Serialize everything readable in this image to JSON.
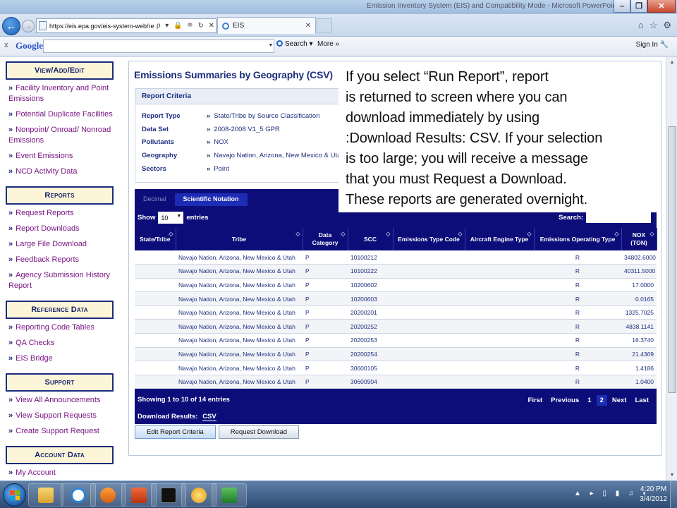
{
  "window": {
    "title": "Emission Inventory System (EIS) and Compatibility Mode - Microsoft PowerPoint",
    "minimize": "–",
    "restore": "❐",
    "close": "✕"
  },
  "browser": {
    "back": "←",
    "forward": "→",
    "url": "https://eis.epa.gov/eis-system-web/reports/g",
    "url_tools": "ρ ▾ 🔒 ≘ ↻ ✕",
    "tab_label": "EIS",
    "tab_close": "✕",
    "icons": [
      "home-icon",
      "star-icon",
      "gear-icon"
    ],
    "icon_glyphs": [
      "⌂",
      "☆",
      "⚙"
    ]
  },
  "google_toolbar": {
    "close": "x",
    "logo": "Google",
    "search_placeholder": "",
    "dropdown": "▼",
    "search_label": "Search",
    "search_arrow": "▾",
    "more_label": "More »",
    "sign_in": "Sign In"
  },
  "sidebar": {
    "bullet": "»",
    "sections": [
      {
        "title": "View/Add/Edit",
        "items": [
          "Facility Inventory and Point Emissions",
          "Potential Duplicate Facilities",
          "Nonpoint/ Onroad/ Nonroad Emissions",
          "Event Emissions",
          "NCD Activity Data"
        ]
      },
      {
        "title": "Reports",
        "items": [
          "Request Reports",
          "Report Downloads",
          "Large File Download",
          "Feedback Reports",
          "Agency Submission History Report"
        ]
      },
      {
        "title": "Reference Data",
        "items": [
          "Reporting Code Tables",
          "QA Checks",
          "EIS Bridge"
        ]
      },
      {
        "title": "Support",
        "items": [
          "View All Announcements",
          "View Support Requests",
          "Create Support Request"
        ]
      },
      {
        "title": "Account Data",
        "items": [
          "My Account"
        ]
      }
    ]
  },
  "main": {
    "title": "Emissions Summaries by Geography (CSV)",
    "criteria_title": "Report Criteria",
    "criteria_bullet": "»",
    "criteria": [
      {
        "label": "Report Type",
        "value": "State/Tribe by Source Classification"
      },
      {
        "label": "Data Set",
        "value": "2008-2008 V1_5 GPR"
      },
      {
        "label": "Pollutants",
        "value": "NOX"
      },
      {
        "label": "Geography",
        "value": "Navajo Nation, Arizona, New Mexico & Utah"
      },
      {
        "label": "Sectors",
        "value": "Point"
      }
    ],
    "tabs": [
      "Decimal",
      "Scientific Notation"
    ],
    "show_label": "Show",
    "show_value": "10",
    "show_arrow": "▼",
    "entries_label": "entries",
    "search_label": "Search:",
    "columns": [
      "State/Tribe",
      "Tribe",
      "Data Category",
      "SCC",
      "Emissions Type Code",
      "Aircraft Engine Type",
      "Emissions Operating Type",
      "NOX (TON)"
    ],
    "sort_glyph": "◇",
    "rows": [
      [
        "",
        "Navajo Nation, Arizona, New Mexico & Utah",
        "P",
        "10100212",
        "",
        "",
        "R",
        "34802.6000"
      ],
      [
        "",
        "Navajo Nation, Arizona, New Mexico & Utah",
        "P",
        "10100222",
        "",
        "",
        "R",
        "40311.5000"
      ],
      [
        "",
        "Navajo Nation, Arizona, New Mexico & Utah",
        "P",
        "10200602",
        "",
        "",
        "R",
        "17.0000"
      ],
      [
        "",
        "Navajo Nation, Arizona, New Mexico & Utah",
        "P",
        "10200603",
        "",
        "",
        "R",
        "0.0165"
      ],
      [
        "",
        "Navajo Nation, Arizona, New Mexico & Utah",
        "P",
        "20200201",
        "",
        "",
        "R",
        "1325.7025"
      ],
      [
        "",
        "Navajo Nation, Arizona, New Mexico & Utah",
        "P",
        "20200252",
        "",
        "",
        "R",
        "4838.1141"
      ],
      [
        "",
        "Navajo Nation, Arizona, New Mexico & Utah",
        "P",
        "20200253",
        "",
        "",
        "R",
        "16.3740"
      ],
      [
        "",
        "Navajo Nation, Arizona, New Mexico & Utah",
        "P",
        "20200254",
        "",
        "",
        "R",
        "21.4369"
      ],
      [
        "",
        "Navajo Nation, Arizona, New Mexico & Utah",
        "P",
        "30600105",
        "",
        "",
        "R",
        "1.4186"
      ],
      [
        "",
        "Navajo Nation, Arizona, New Mexico & Utah",
        "P",
        "30600904",
        "",
        "",
        "R",
        "1.0400"
      ]
    ],
    "info_text": "Showing 1 to 10 of 14 entries",
    "download_label": "Download Results:",
    "download_link": "CSV",
    "pager": {
      "first": "First",
      "previous": "Previous",
      "pages": [
        "1",
        "2"
      ],
      "current": "2",
      "next": "Next",
      "last": "Last"
    },
    "buttons": {
      "edit": "Edit Report Criteria",
      "request": "Request Download"
    }
  },
  "callout": {
    "text": "If you select “Run Report”, report\nis returned to screen where you can\ndownload immediately by using\n:Download Results: CSV. If your selection\nis too large; you will receive a message\nthat you must Request a Download.\nThese reports are generated overnight."
  },
  "scrollbar": {
    "up": "▲",
    "down": "▼"
  },
  "taskbar": {
    "apps": [
      "file-explorer-icon",
      "internet-explorer-icon",
      "media-player-icon",
      "powerpoint-icon",
      "command-prompt-icon",
      "file-manager-icon",
      "excel-icon"
    ],
    "tray_icons": "▲ ▸ ▯ ▮ ♫ ◐",
    "time": "4:20 PM",
    "date": "3/4/2012"
  },
  "colors": {
    "navy": "#0d0d7a",
    "link_purple": "#7a1784",
    "sidebar_header_bg": "#fdf5d8",
    "title_blue": "#1e2f7e"
  }
}
